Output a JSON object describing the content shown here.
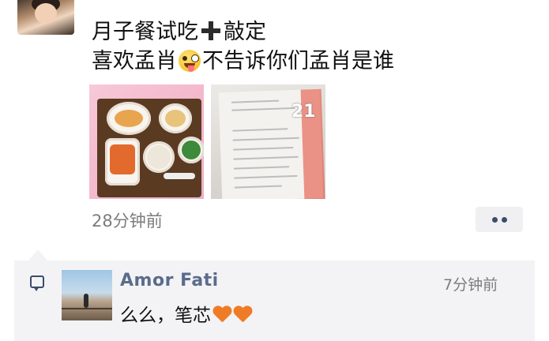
{
  "post": {
    "line1_a": "月子餐试吃",
    "line1_icon": "heavy-plus-icon",
    "line1_b": "敲定",
    "line2_a": "喜欢孟肖",
    "line2_emoji": "zany-face-emoji",
    "line2_b": "不告诉你们孟肖是谁",
    "photos": [
      {
        "name": "meal-tray-photo"
      },
      {
        "name": "document-photo",
        "badge": "21"
      }
    ],
    "time": "28分钟前",
    "more_icon": "ellipsis-icon"
  },
  "comment": {
    "icon": "comment-icon",
    "user": "Amor  Fati",
    "time": "7分钟前",
    "text": "么么，笔芯",
    "emojis": [
      "orange-heart-emoji",
      "orange-heart-emoji"
    ]
  },
  "colors": {
    "name_link": "#5a6c8c",
    "time_gray": "#7c7c7c",
    "comment_bg": "#f3f3f5",
    "heart": "#f07b26"
  }
}
